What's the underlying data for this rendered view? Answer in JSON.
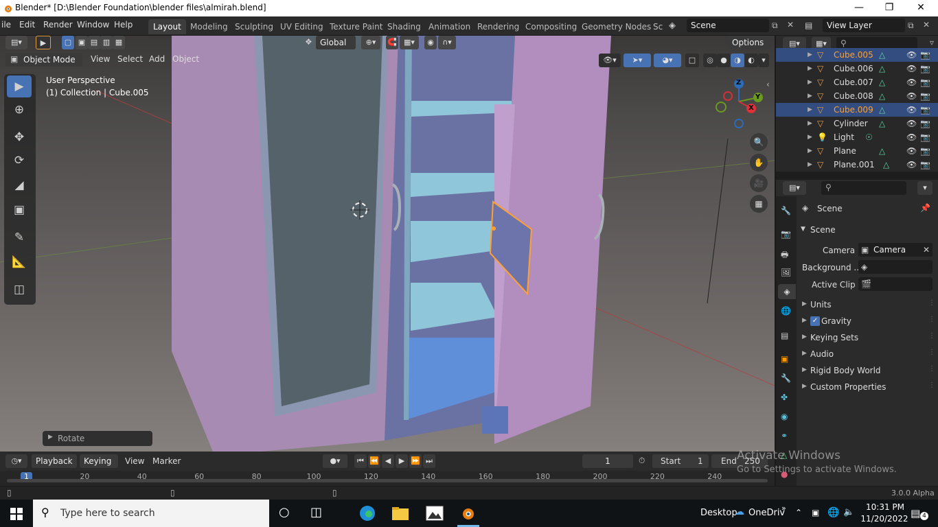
{
  "window": {
    "title": "Blender* [D:\\Blender Foundation\\blender files\\almirah.blend]",
    "minimize": "—",
    "maximize": "❐",
    "close": "✕"
  },
  "menubar": {
    "items": [
      "ile",
      "Edit",
      "Render",
      "Window",
      "Help"
    ],
    "workspaces": [
      "Layout",
      "Modeling",
      "Sculpting",
      "UV Editing",
      "Texture Paint",
      "Shading",
      "Animation",
      "Rendering",
      "Compositing",
      "Geometry Nodes",
      "Sc"
    ],
    "scene": "Scene",
    "view_layer": "View Layer"
  },
  "viewport_header": {
    "mode": "Object Mode",
    "menus": [
      "View",
      "Select",
      "Add",
      "Object"
    ],
    "orientation": "Global",
    "options": "Options"
  },
  "viewport": {
    "perspective": "User Perspective",
    "collection": "(1) Collection | Cube.005",
    "operator_panel": "Rotate",
    "gizmo": {
      "x": "X",
      "y": "Y",
      "z": "Z"
    }
  },
  "outliner": {
    "rows": [
      {
        "name": "Cube.005",
        "selected": true,
        "icon": "mesh"
      },
      {
        "name": "Cube.006",
        "selected": false,
        "icon": "mesh"
      },
      {
        "name": "Cube.007",
        "selected": false,
        "icon": "mesh"
      },
      {
        "name": "Cube.008",
        "selected": false,
        "icon": "mesh"
      },
      {
        "name": "Cube.009",
        "selected": true,
        "icon": "mesh"
      },
      {
        "name": "Cylinder",
        "selected": false,
        "icon": "mesh"
      },
      {
        "name": "Light",
        "selected": false,
        "icon": "light"
      },
      {
        "name": "Plane",
        "selected": false,
        "icon": "mesh"
      },
      {
        "name": "Plane.001",
        "selected": false,
        "icon": "mesh"
      }
    ]
  },
  "properties": {
    "context": "Scene",
    "panel": "Scene",
    "camera_label": "Camera",
    "camera_value": "Camera",
    "background_label": "Background ...",
    "active_clip_label": "Active Clip",
    "sections": [
      "Units",
      "Gravity",
      "Keying Sets",
      "Audio",
      "Rigid Body World",
      "Custom Properties"
    ],
    "gravity_checked": true
  },
  "timeline": {
    "menus": [
      "Playback",
      "Keying",
      "View",
      "Marker"
    ],
    "current_frame": "1",
    "start_label": "Start",
    "start": "1",
    "end_label": "End",
    "end": "250",
    "ruler": [
      "1",
      "20",
      "40",
      "60",
      "80",
      "100",
      "120",
      "140",
      "160",
      "180",
      "200",
      "220",
      "240"
    ]
  },
  "statusbar": {
    "version": "3.0.0 Alpha"
  },
  "watermark": {
    "line1": "Activate Windows",
    "line2": "Go to Settings to activate Windows."
  },
  "taskbar": {
    "search_placeholder": "Type here to search",
    "desktop": "Desktop",
    "onedrive": "OneDriv",
    "time": "10:31 PM",
    "date": "11/20/2022",
    "notifications": "4"
  },
  "colors": {
    "accent_blue": "#4772b3",
    "selection_orange": "#ffa033",
    "mesh_icon": "#e6a04a"
  }
}
